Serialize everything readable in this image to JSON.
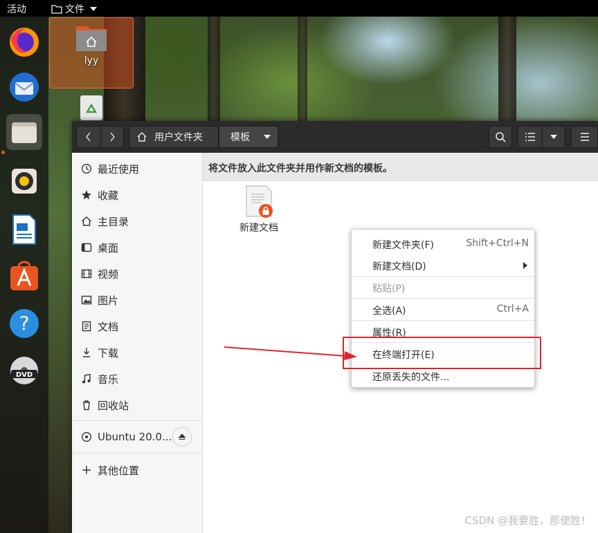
{
  "topbar": {
    "activities": "活动",
    "app_menu": "文件"
  },
  "dock": {
    "items": [
      "firefox-icon",
      "thunderbird-icon",
      "files-icon",
      "rhythmbox-icon",
      "libreoffice-writer-icon",
      "software-icon",
      "help-icon",
      "dvd-icon"
    ]
  },
  "desktop": {
    "home_label": "lyy"
  },
  "window": {
    "path": {
      "home": "用户文件夹",
      "current": "模板"
    },
    "sidebar": {
      "items": [
        "最近使用",
        "收藏",
        "主目录",
        "桌面",
        "视频",
        "图片",
        "文档",
        "下载",
        "音乐",
        "回收站"
      ],
      "device": "Ubuntu 20.0...",
      "other": "其他位置"
    },
    "info_text": "将文件放入此文件夹并用作新文档的模板。",
    "files": [
      {
        "label": "新建文档"
      }
    ]
  },
  "context_menu": {
    "items": [
      {
        "label": "新建文件夹(F)",
        "accel": "Shift+Ctrl+N"
      },
      {
        "label": "新建文档(D)",
        "accel": ""
      },
      {
        "label": "粘贴(P)",
        "accel": ""
      },
      {
        "label": "全选(A)",
        "accel": "Ctrl+A"
      },
      {
        "label": "属性(R)",
        "accel": ""
      },
      {
        "label": "在终端打开(E)",
        "accel": ""
      },
      {
        "label": "还原丢失的文件...",
        "accel": ""
      }
    ]
  },
  "watermark": "CSDN @我要胜，那便胜！",
  "colors": {
    "accent": "#e95420",
    "annotation": "#e0232b"
  }
}
